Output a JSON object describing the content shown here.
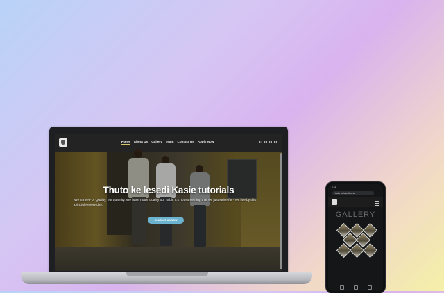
{
  "laptop": {
    "nav": {
      "items": [
        "Home",
        "About Us",
        "Gallery",
        "Team",
        "Contact Us",
        "Apply Now"
      ],
      "active": "Home"
    },
    "hero": {
      "title": "Thuto ke lesedi Kasie tutorials",
      "text": "We Strive For Quality, not quantity. We have made quality our habit. It's not something that we just strive for - we live by this principle every day.",
      "button": "CONTACT US NOW"
    }
  },
  "phone": {
    "status_time": "4:58",
    "url": "thuto ke lesedi.co.za",
    "heading": "GALLERY"
  },
  "colors": {
    "accent": "#6bb3cf",
    "nav_bg": "#232323",
    "active_underline": "#d7c36a"
  }
}
